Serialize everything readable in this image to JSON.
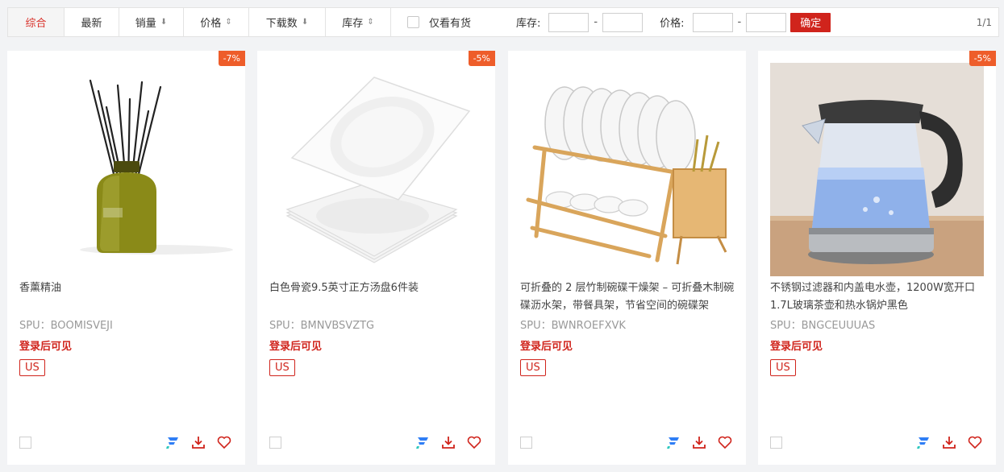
{
  "toolbar": {
    "sorts": [
      {
        "label": "综合",
        "arrow": ""
      },
      {
        "label": "最新",
        "arrow": ""
      },
      {
        "label": "销量",
        "arrow": "⬇"
      },
      {
        "label": "价格",
        "arrow": "⇕"
      },
      {
        "label": "下载数",
        "arrow": "⬇"
      },
      {
        "label": "库存",
        "arrow": "⇕"
      }
    ],
    "in_stock_label": "仅看有货",
    "stock_label": "库存:",
    "price_label": "价格:",
    "dash": "-",
    "confirm_label": "确定",
    "pager": "1/1"
  },
  "colors": {
    "accent": "#d0241c",
    "badge": "#ee5d2a"
  },
  "products": [
    {
      "discount": "-7%",
      "title": "香薰精油",
      "spu": "SPU：BOOMISVEJI",
      "price_hint": "登录后可见",
      "region": "US",
      "icon": "reed-diffuser-image"
    },
    {
      "discount": "-5%",
      "title": "白色骨瓷9.5英寸正方汤盘6件装",
      "spu": "SPU：BMNVBSVZTG",
      "price_hint": "登录后可见",
      "region": "US",
      "icon": "plates-image"
    },
    {
      "discount": "",
      "title": "可折叠的 2 层竹制碗碟干燥架 – 可折叠木制碗碟沥水架，带餐具架，节省空间的碗碟架",
      "spu": "SPU：BWNROEFXVK",
      "price_hint": "登录后可见",
      "region": "US",
      "icon": "dish-rack-image"
    },
    {
      "discount": "-5%",
      "title": "不锈钢过滤器和内盖电水壶，1200W宽开口1.7L玻璃茶壶和热水锅炉黑色",
      "spu": "SPU：BNGCEUUUAS",
      "price_hint": "登录后可见",
      "region": "US",
      "icon": "kettle-image"
    }
  ]
}
